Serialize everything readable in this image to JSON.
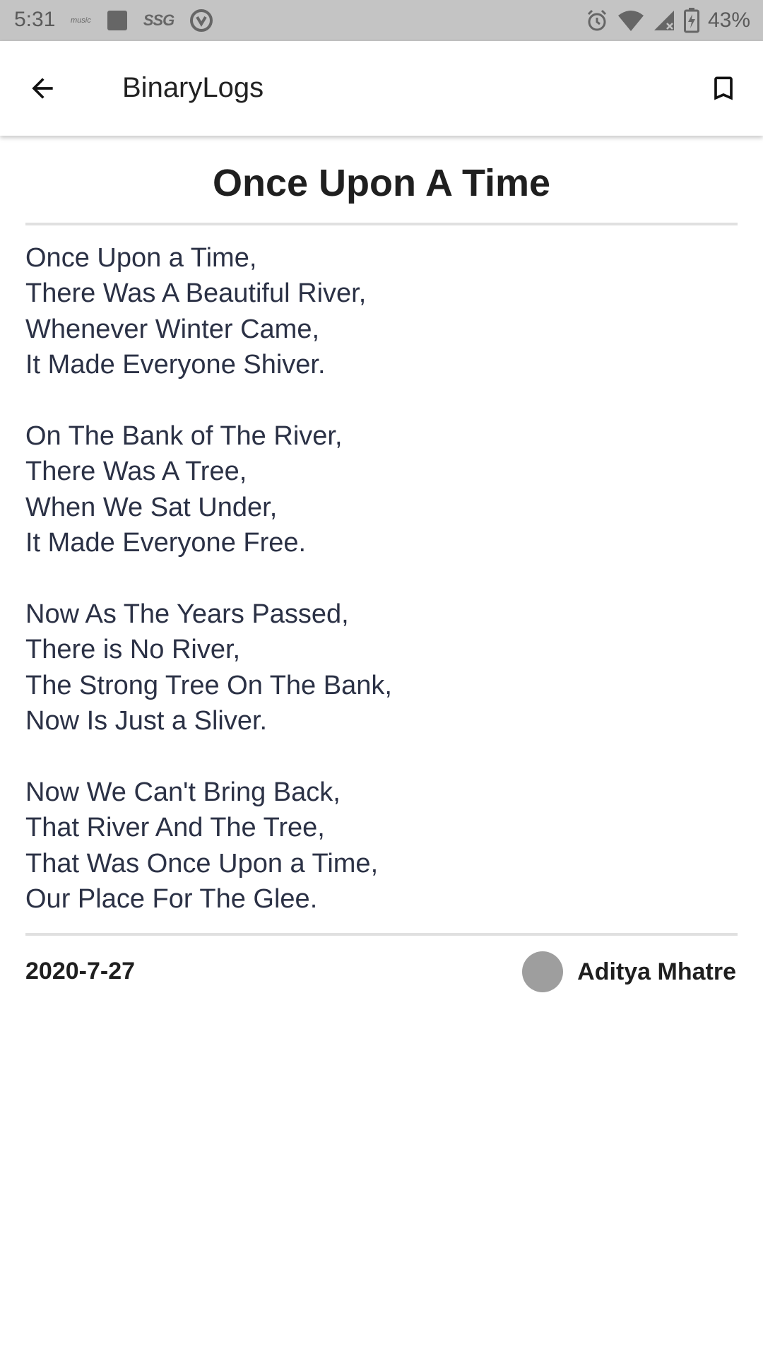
{
  "status_bar": {
    "time": "5:31",
    "music_label": "music",
    "ssg_label": "SSG",
    "battery_percent": "43%",
    "left_icons": [
      "amazon-music-icon",
      "square-app-icon",
      "ssg-icon",
      "vpn-icon"
    ],
    "right_icons": [
      "alarm-icon",
      "wifi-icon",
      "cell-signal-icon",
      "battery-charging-icon"
    ]
  },
  "app_bar": {
    "title": "BinaryLogs",
    "back_icon": "back-arrow-icon",
    "bookmark_icon": "bookmark-icon"
  },
  "post": {
    "title": "Once Upon A Time",
    "stanzas": [
      [
        "Once Upon a Time,",
        "There Was A Beautiful River,",
        "Whenever Winter Came,",
        "It Made Everyone Shiver."
      ],
      [
        "On The Bank of The River,",
        "There Was A Tree,",
        "When We Sat Under,",
        "It Made Everyone Free."
      ],
      [
        "Now As The Years Passed,",
        "There is No River,",
        "The Strong Tree On The Bank,",
        "Now Is Just a Sliver."
      ],
      [
        "Now We Can't Bring Back,",
        "That River And The Tree,",
        "That Was Once Upon a Time,",
        "Our Place For The Glee."
      ]
    ],
    "date": "2020-7-27",
    "author": "Aditya Mhatre"
  },
  "colors": {
    "status_bar_bg": "#c4c4c4",
    "poem_text": "#2b3145",
    "title_text": "#1f1f1f",
    "divider": "#e0e0e0",
    "avatar": "#9e9e9e"
  }
}
